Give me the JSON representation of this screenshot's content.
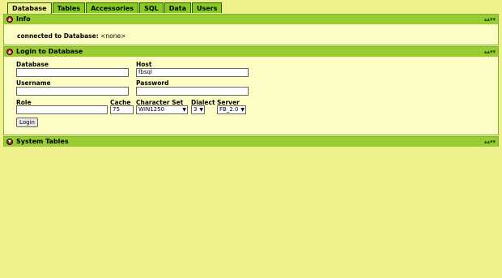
{
  "tabs": [
    "Database",
    "Tables",
    "Accessories",
    "SQL",
    "Data",
    "Users"
  ],
  "info": {
    "title": "Info",
    "connected_label": "connected to Database:",
    "connected_value": "<none>"
  },
  "login": {
    "title": "Login to Database",
    "database_label": "Database",
    "database_value": "",
    "host_label": "Host",
    "host_value": "fbsql",
    "username_label": "Username",
    "username_value": "",
    "password_label": "Password",
    "password_value": "",
    "role_label": "Role",
    "role_value": "",
    "cache_label": "Cache",
    "cache_value": "75",
    "charset_label": "Character Set",
    "charset_value": "WIN1250",
    "dialect_label": "Dialect",
    "dialect_value": "3",
    "server_label": "Server",
    "server_value": "FB_2.0",
    "login_button": "Login"
  },
  "system_tables": {
    "title": "System Tables"
  },
  "panel_arrows": "▴▴▾▾"
}
